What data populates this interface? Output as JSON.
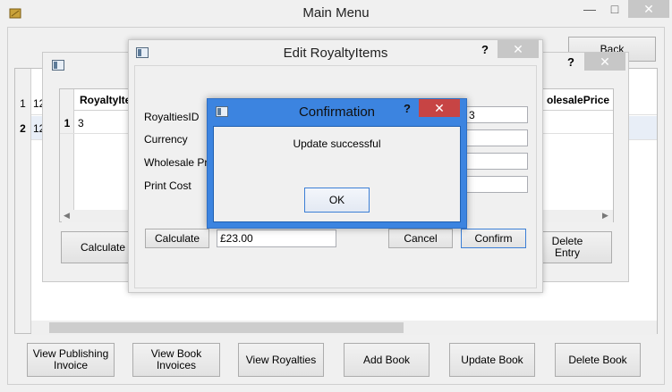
{
  "main_window": {
    "title": "Main Menu",
    "minimize_glyph": "—",
    "maximize_glyph": "□",
    "close_glyph": "✕",
    "back_label": "Back",
    "table_rows": [
      {
        "num": "1",
        "value": "12"
      },
      {
        "num": "2",
        "value": "12"
      }
    ],
    "buttons": [
      "View Publishing\nInvoice",
      "View Book\nInvoices",
      "View Royalties",
      "Add Book",
      "Update Book",
      "Delete Book"
    ]
  },
  "royalties_window": {
    "help_glyph": "?",
    "close_glyph": "✕",
    "col_first": "RoyaltyIte",
    "col_last": "olesalePrice",
    "row": {
      "num": "1",
      "value": "3"
    },
    "calculate_label": "Calculate",
    "delete_label": "Delete\nEntry",
    "scroll_left": "◀",
    "scroll_right": "▶"
  },
  "edit_window": {
    "title": "Edit RoyaltyItems",
    "help_glyph": "?",
    "close_glyph": "✕",
    "labels": [
      "RoyaltiesID",
      "Currency",
      "Wholesale Pric",
      "Print Cost"
    ],
    "field_values": [
      "3",
      "",
      "",
      ""
    ],
    "calculate_label": "Calculate",
    "price_value": "£23.00",
    "cancel_label": "Cancel",
    "confirm_label": "Confirm"
  },
  "confirmation_dialog": {
    "title": "Confirmation",
    "help_glyph": "?",
    "close_glyph": "✕",
    "message": "Update successful",
    "ok_label": "OK"
  },
  "colors": {
    "dialog_accent": "#3c84e0",
    "dialog_close": "#c74444"
  }
}
